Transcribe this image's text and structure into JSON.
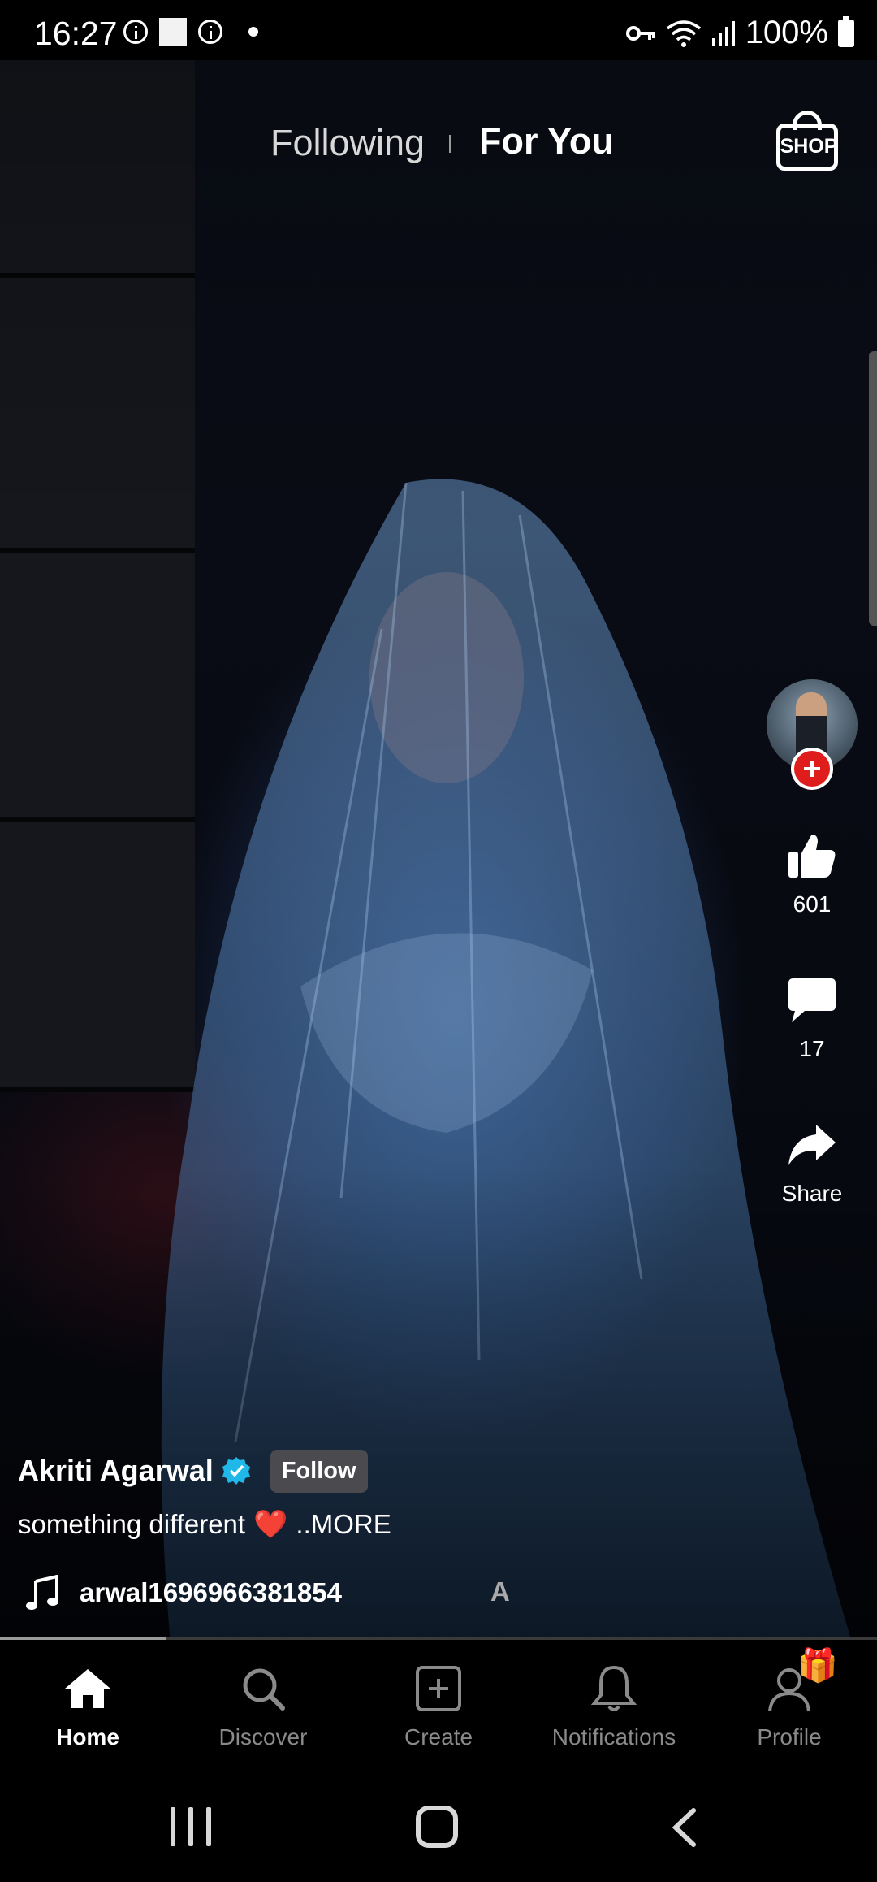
{
  "status_bar": {
    "time": "16:27",
    "battery": "100%"
  },
  "header": {
    "tabs": [
      {
        "label": "Following",
        "active": false
      },
      {
        "label": "For You",
        "active": true
      }
    ],
    "shop_label": "SHOP"
  },
  "actions": {
    "like_count": "601",
    "comment_count": "17",
    "share_label": "Share"
  },
  "post": {
    "author": "Akriti Agarwal",
    "follow_label": "Follow",
    "caption": "something different",
    "caption_emoji": "❤️",
    "more_label": "..MORE",
    "music": "arwal1696966381854",
    "music_trailing": "A",
    "progress": 0.19
  },
  "nav": {
    "items": [
      {
        "label": "Home",
        "active": true
      },
      {
        "label": "Discover",
        "active": false
      },
      {
        "label": "Create",
        "active": false
      },
      {
        "label": "Notifications",
        "active": false
      },
      {
        "label": "Profile",
        "active": false
      }
    ]
  },
  "colors": {
    "accent_red": "#e01d1d",
    "verified_blue": "#20b8e8"
  }
}
